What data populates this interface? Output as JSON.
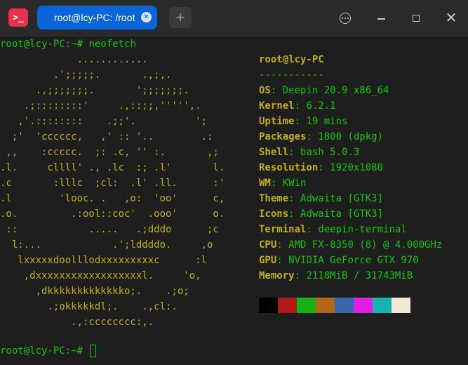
{
  "titlebar": {
    "app_icon_glyph": ">_",
    "tab_title": "root@lcy-PC: /root",
    "tab_close_glyph": "×",
    "add_tab_glyph": "+",
    "close_glyph": "✕"
  },
  "terminal": {
    "command_prompt": "root@lcy-PC:~# ",
    "command": "neofetch",
    "final_prompt": "root@lcy-PC:~# ",
    "logo": [
      "             ............",
      "         .';;;;;.       .,;,.",
      "      .,;;;;;;;.       ';;;;;;;.",
      "    .;::::::::'     .,::;;,''''',.",
      "   ,'.::::::::    .;;'.          ';",
      "  ;'  'cccccc,   ,' :: '..        .:",
      " ,,    :ccccc.  ;: .c, '' :.       ,;",
      ".l.     cllll' ., .lc  :; .l'       l.",
      ".c       :lllc  ;cl:  .l' .ll.      :'",
      ".l        'looc. .   ,o:  'oo'      c,",
      ".o.         .:ool::coc'  .ooo'      o.",
      " ::            .....   .;dddo      ;c",
      "  l:...            .';lddddo.     ,o",
      "   lxxxxxdoolllodxxxxxxxxxc      :l",
      "    ,dxxxxxxxxxxxxxxxxxxl.     'o,",
      "      ,dkkkkkkkkkkkkko;.    .;o;",
      "        .;okkkkkdl;.    .,cl:.",
      "            .,:cccccccc:,."
    ],
    "info": {
      "user_host": "root@lcy-PC",
      "separator": "-----------",
      "rows": [
        {
          "key": "OS",
          "value": "Deepin 20.9 x86_64"
        },
        {
          "key": "Kernel",
          "value": "6.2.1"
        },
        {
          "key": "Uptime",
          "value": "19 mins"
        },
        {
          "key": "Packages",
          "value": "1800 (dpkg)"
        },
        {
          "key": "Shell",
          "value": "bash 5.0.3"
        },
        {
          "key": "Resolution",
          "value": "1920x1080"
        },
        {
          "key": "WM",
          "value": "KWin"
        },
        {
          "key": "Theme",
          "value": "Adwaita [GTK3]"
        },
        {
          "key": "Icons",
          "value": "Adwaita [GTK3]"
        },
        {
          "key": "Terminal",
          "value": "deepin-terminal"
        },
        {
          "key": "CPU",
          "value": "AMD FX-8350 (8) @ 4.000GHz"
        },
        {
          "key": "GPU",
          "value": "NVIDIA GeForce GTX 970"
        },
        {
          "key": "Memory",
          "value": "2118MiB / 31743MiB"
        }
      ],
      "palette": [
        "#000000",
        "#b21818",
        "#18b218",
        "#b26818",
        "#3a65a8",
        "#e31ee3",
        "#18b2b2",
        "#efe9d6"
      ]
    }
  }
}
